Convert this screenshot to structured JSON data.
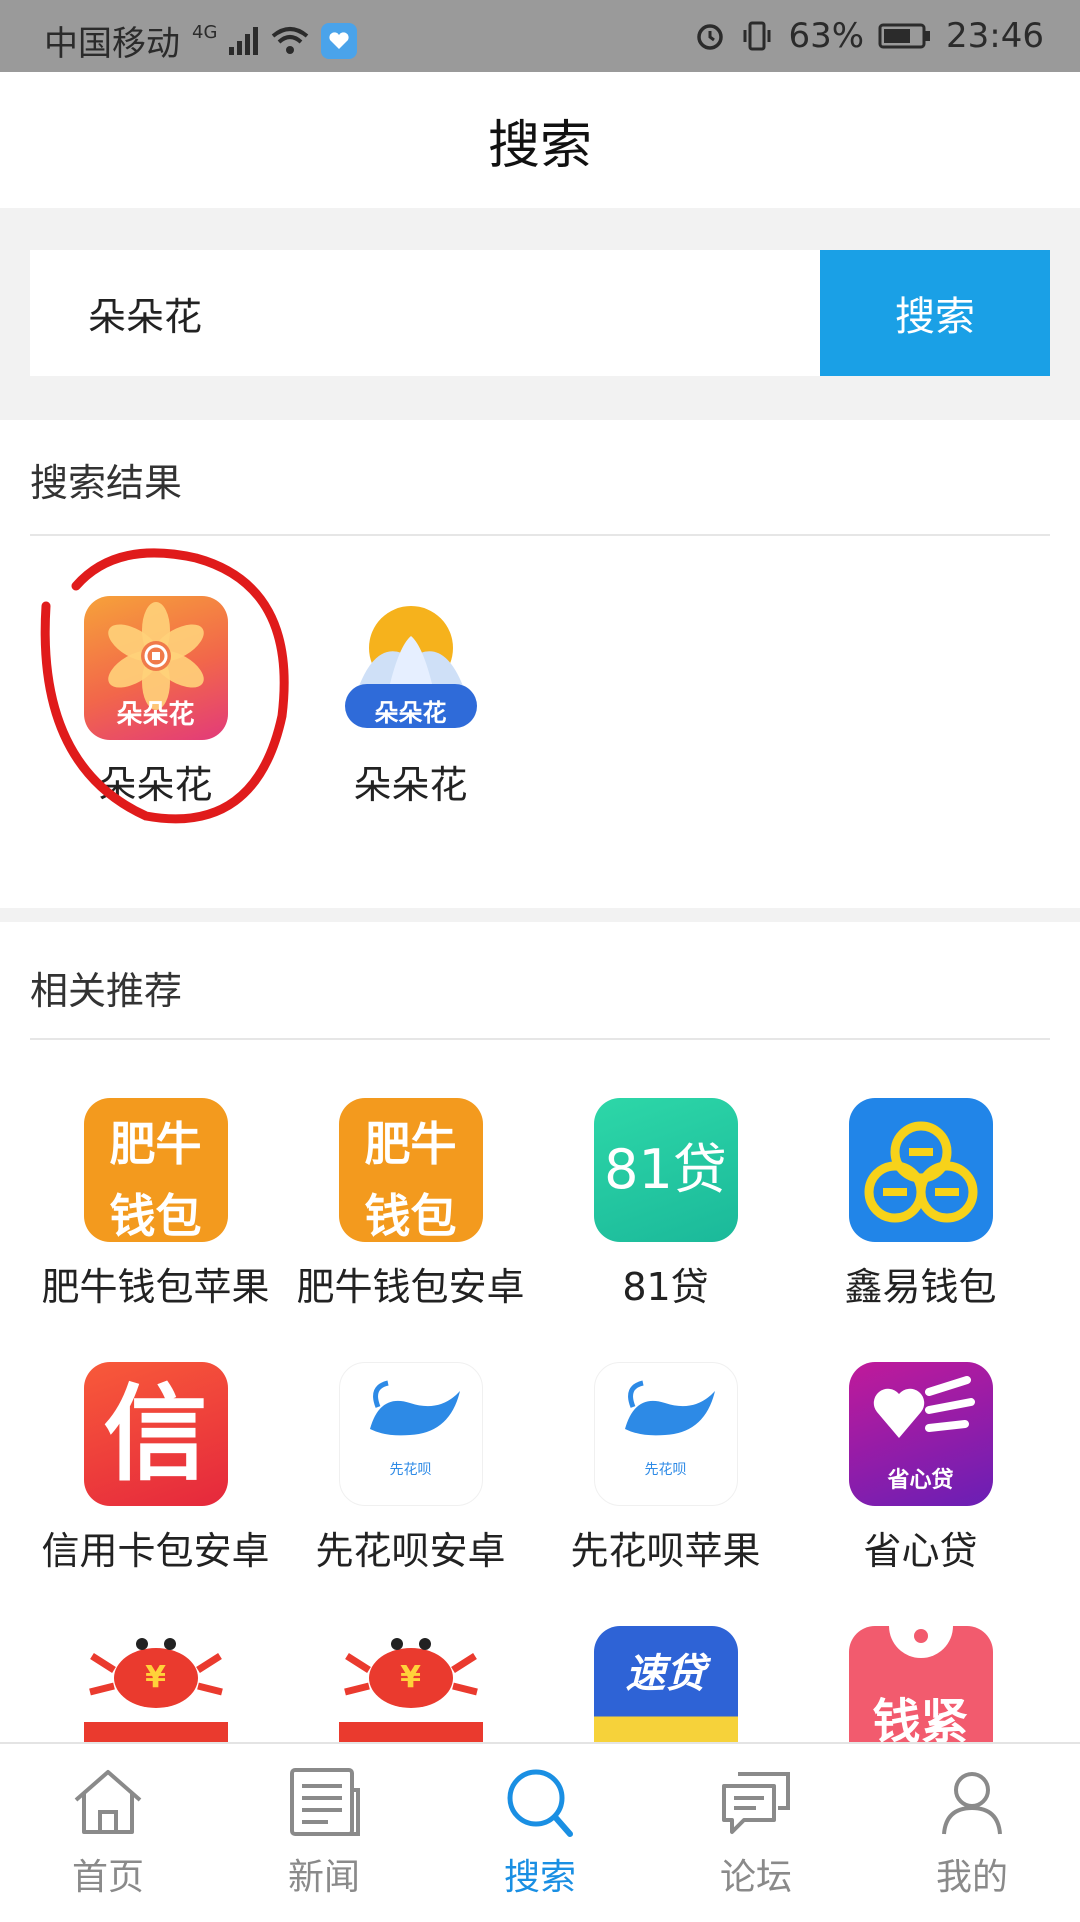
{
  "status_bar": {
    "carrier": "中国移动",
    "network": "4G",
    "battery": "63%",
    "time": "23:46"
  },
  "header": {
    "title": "搜索"
  },
  "search": {
    "query": "朵朵花",
    "button_label": "搜索"
  },
  "results": {
    "title": "搜索结果",
    "items": [
      {
        "label": "朵朵花",
        "icon_text": "朵朵花",
        "icon": "duoduohua-pink-flower-icon"
      },
      {
        "label": "朵朵花",
        "icon_text": "朵朵花",
        "icon": "duoduohua-blue-lotus-icon"
      }
    ]
  },
  "recommend": {
    "title": "相关推荐",
    "items": [
      {
        "label": "肥牛钱包苹果",
        "icon_text_1": "肥牛",
        "icon_text_2": "钱包",
        "icon": "feiniu-wallet-icon"
      },
      {
        "label": "肥牛钱包安卓",
        "icon_text_1": "肥牛",
        "icon_text_2": "钱包",
        "icon": "feiniu-wallet-icon"
      },
      {
        "label": "81贷",
        "icon_text": "81贷",
        "icon": "81dai-icon"
      },
      {
        "label": "鑫易钱包",
        "icon": "xinyi-wallet-icon"
      },
      {
        "label": "信用卡包安卓",
        "icon_text": "信",
        "icon": "credit-card-wallet-icon"
      },
      {
        "label": "先花呗安卓",
        "icon_text": "先花呗",
        "icon": "xianhuabei-icon"
      },
      {
        "label": "先花呗苹果",
        "icon_text": "先花呗",
        "icon": "xianhuabei-icon"
      },
      {
        "label": "省心贷",
        "icon_text": "省心贷",
        "icon": "shengxindai-icon"
      },
      {
        "label": "",
        "icon_text": "¥",
        "icon": "crab-icon"
      },
      {
        "label": "",
        "icon_text": "¥",
        "icon": "crab-icon"
      },
      {
        "label": "",
        "icon_text": "速贷",
        "icon": "sudai-icon"
      },
      {
        "label": "",
        "icon_text": "钱紧",
        "icon": "qianjin-icon"
      }
    ]
  },
  "tabbar": {
    "items": [
      {
        "label": "首页",
        "icon": "home-icon"
      },
      {
        "label": "新闻",
        "icon": "news-icon"
      },
      {
        "label": "搜索",
        "icon": "search-icon"
      },
      {
        "label": "论坛",
        "icon": "forum-icon"
      },
      {
        "label": "我的",
        "icon": "profile-icon"
      }
    ],
    "active": "搜索"
  },
  "colors": {
    "accent": "#1aa0e6",
    "active_tab": "#1a8fe3",
    "annotation": "#e01b1b"
  }
}
